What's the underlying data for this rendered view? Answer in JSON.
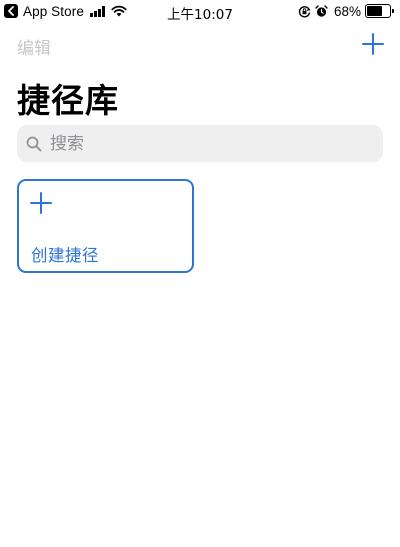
{
  "status_bar": {
    "back_app": "App Store",
    "time": "上午10:07",
    "battery_percent": "68%",
    "battery_level": 0.68,
    "icons": [
      "back-arrow-icon",
      "cellular-signal-icon",
      "wifi-icon",
      "rotation-lock-icon",
      "alarm-icon",
      "battery-icon"
    ]
  },
  "nav": {
    "edit_label": "编辑",
    "add_icon": "plus-icon"
  },
  "page_title": "捷径库",
  "search": {
    "placeholder": "搜索",
    "value": ""
  },
  "create_card": {
    "label": "创建捷径",
    "icon": "plus-icon"
  },
  "colors": {
    "accent": "#2d74d6",
    "disabled_text": "#c7c7cc",
    "search_bg": "#efeff0",
    "placeholder": "#8e8e93"
  }
}
